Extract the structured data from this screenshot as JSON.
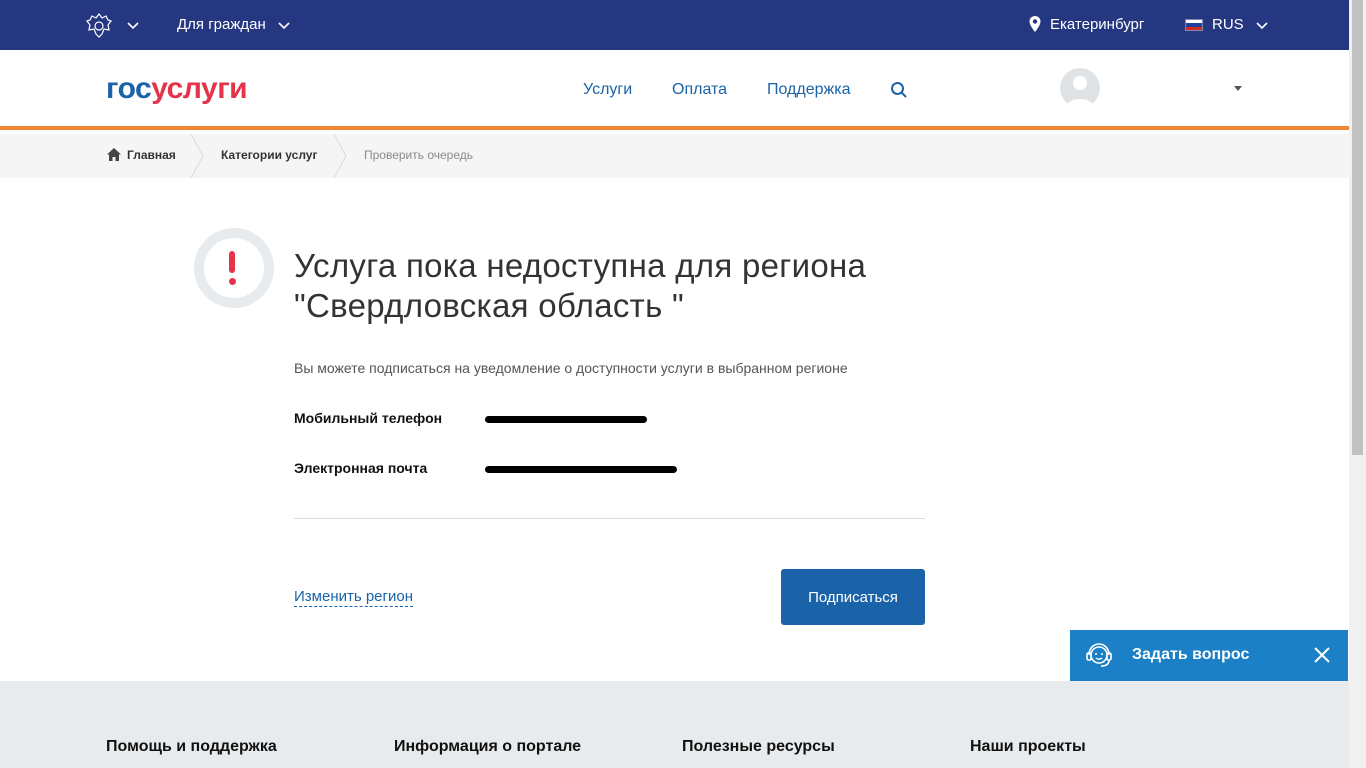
{
  "topbar": {
    "for_citizens": "Для граждан",
    "city": "Екатеринбург",
    "language": "RUS",
    "color": "#253780"
  },
  "header": {
    "logo_part1": "гос",
    "logo_part2": "услуги",
    "nav": [
      "Услуги",
      "Оплата",
      "Поддержка"
    ]
  },
  "breadcrumb": {
    "items": [
      "Главная",
      "Категории услуг",
      "Проверить очередь"
    ]
  },
  "main": {
    "title_line1": "Услуга пока недоступна для региона",
    "title_line2": "\"Свердловская область \"",
    "subtitle": "Вы можете подписаться на уведомление о доступности услуги в выбранном регионе",
    "phone_label": "Мобильный телефон",
    "email_label": "Электронная почта",
    "change_region": "Изменить регион",
    "subscribe": "Подписаться"
  },
  "chat": {
    "label": "Задать вопрос",
    "color": "#1b80c5"
  },
  "footer": {
    "columns": [
      "Помощь и поддержка",
      "Информация о портале",
      "Полезные ресурсы",
      "Наши проекты"
    ]
  },
  "icons": [
    "emblem-icon",
    "chevron-down-icon",
    "location-pin-icon",
    "flag-icon",
    "search-icon",
    "avatar-icon",
    "home-icon",
    "alert-icon",
    "headset-icon",
    "close-icon"
  ]
}
